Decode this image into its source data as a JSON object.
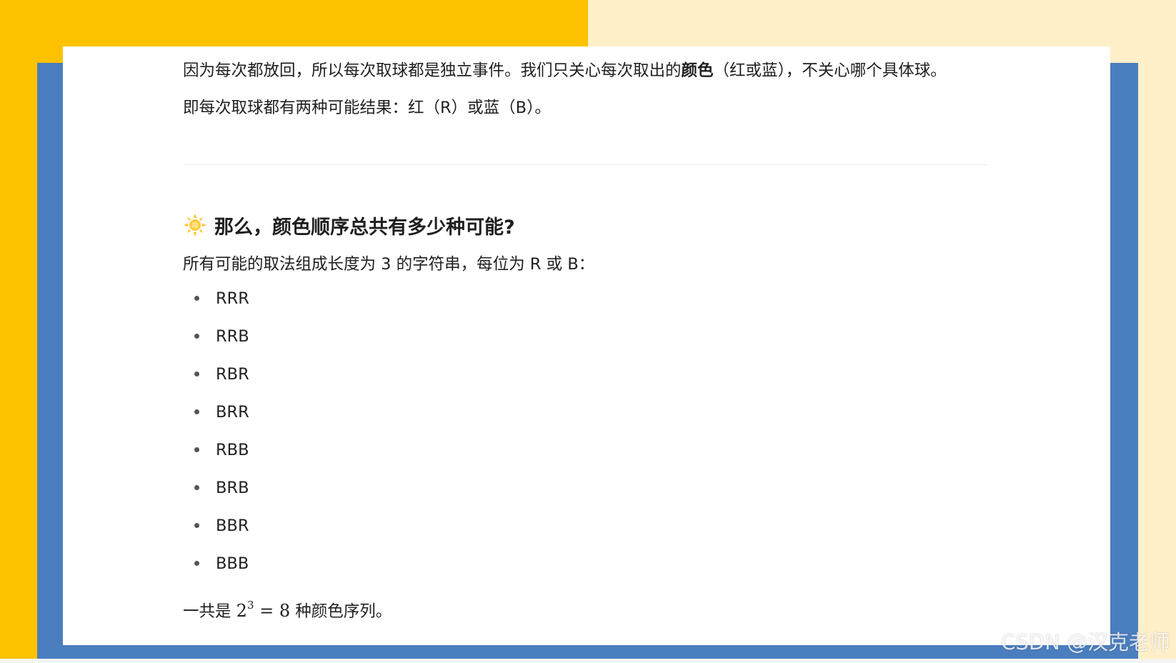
{
  "paragraph1": {
    "before": "因为每次都放回，所以每次取球都是独立事件。我们只关心每次取出的",
    "bold": "颜色",
    "after": "（红或蓝），不关心哪个具体球。"
  },
  "paragraph2": "即每次取球都有两种可能结果：红（R）或蓝（B）。",
  "heading": {
    "icon": "sun-icon",
    "text": "那么，颜色顺序总共有多少种可能?"
  },
  "paragraph3": "所有可能的取法组成长度为 3 的字符串，每位为 R 或 B：",
  "list_items": [
    "RRR",
    "RRB",
    "RBR",
    "BRR",
    "RBB",
    "BRB",
    "BBR",
    "BBB"
  ],
  "conclusion": {
    "prefix": "一共是 ",
    "base": "2",
    "exponent": "3",
    "equals": " = 8",
    "suffix": " 种颜色序列。"
  },
  "watermark": "CSDN @汉克老师",
  "colors": {
    "yellow": "#FFC200",
    "cream": "#FFF0C9",
    "blue": "#4A7EBE",
    "sun": "#FFC83D"
  }
}
